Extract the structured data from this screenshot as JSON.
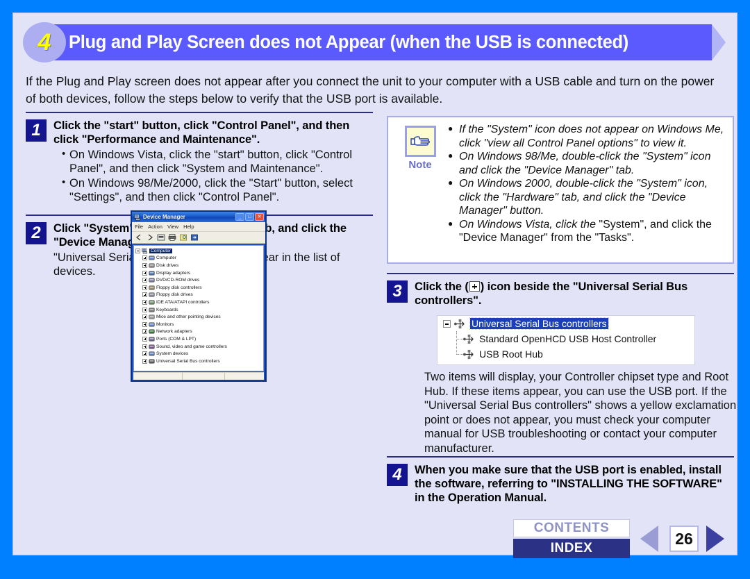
{
  "header": {
    "number": "4",
    "title": "Plug and Play Screen does not Appear (when the USB is connected)"
  },
  "intro": "If the Plug and Play screen does not appear after you connect the unit to your computer with a USB cable and turn on the power of both devices, follow the steps below to verify that the USB port is available.",
  "steps": {
    "one": {
      "number": "1",
      "heading": "Click the \"start\" button, click \"Control Panel\", and then click \"Performance and Maintenance\".",
      "bullets": [
        "On Windows Vista, click the \"start\" button, click \"Control Panel\", and then click \"System and Maintenance\".",
        "On Windows 98/Me/2000, click the \"Start\" button, select \"Settings\", and then click \"Control Panel\"."
      ]
    },
    "two": {
      "number": "2",
      "heading": "Click \"System\", click the \"Hardware\" tab, and click the \"Device Manager\" button.",
      "sub": "\"Universal Serial Bus controllers\" will appear in the list of devices."
    },
    "three": {
      "number": "3",
      "heading_before": "Click the (",
      "heading_after": ") icon beside the \"Universal Serial Bus controllers\"."
    },
    "four": {
      "number": "4",
      "heading": "When you make sure that the USB port is enabled, install the software, referring to \"INSTALLING THE SOFTWARE\" in the Operation Manual."
    }
  },
  "note": {
    "label": "Note",
    "bullets": [
      "If the \"System\" icon does not appear on Windows Me, click \"view all Control Panel options\" to view it.",
      "On Windows 98/Me, double-click the \"System\" icon and click the \"Device Manager\" tab.",
      "On Windows 2000, double-click the \"System\" icon, click the \"Hardware\" tab, and click the \"Device Manager\" button."
    ],
    "bullet4_italic": "On Windows Vista, click the ",
    "bullet4_roman": "\"System\", and click the \"Device Manager\" from the \"Tasks\"."
  },
  "device_manager": {
    "title": "Device Manager",
    "menus": [
      "File",
      "Action",
      "View",
      "Help"
    ],
    "window_buttons": [
      "minimize",
      "maximize",
      "close"
    ],
    "root": "Computer",
    "tree": [
      "Computer",
      "Disk drives",
      "Display adapters",
      "DVD/CD-ROM drives",
      "Floppy disk controllers",
      "Floppy disk drives",
      "IDE ATA/ATAPI controllers",
      "Keyboards",
      "Mice and other pointing devices",
      "Monitors",
      "Network adapters",
      "Ports (COM & LPT)",
      "Sound, video and game controllers",
      "System devices",
      "Universal Serial Bus controllers"
    ]
  },
  "usb_figure": {
    "parent": "Universal Serial Bus controllers",
    "children": [
      "Standard OpenHCD USB Host Controller",
      "USB Root Hub"
    ]
  },
  "tail": "Two items will display, your Controller chipset type and Root Hub. If these items appear, you can use the USB port. If the \"Universal Serial Bus controllers\" shows a yellow exclamation point or does not appear, you must check your computer manual for USB troubleshooting or contact your computer manufacturer.",
  "footer": {
    "contents": "CONTENTS",
    "index": "INDEX",
    "page": "26",
    "prev_icon": "triangle-left-icon",
    "next_icon": "triangle-right-icon"
  },
  "colors": {
    "frame": "#0080ff",
    "sheet": "#e2e3f7",
    "banner": "#5a5aff",
    "banner_number": "#ffff00",
    "step_box": "#141491",
    "rule": "#2b2b8c",
    "index_button": "#2b3285",
    "note_border": "#a7abe8",
    "note_icon_bg": "#fdfbd0",
    "tree_selection": "#1a3fb8"
  }
}
